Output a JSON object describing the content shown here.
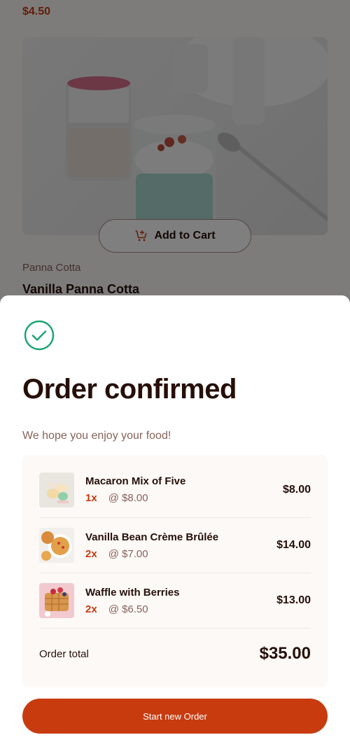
{
  "background": {
    "prev_price": "$4.50",
    "add_to_cart_label": "Add to Cart",
    "product_category": "Panna Cotta",
    "product_name": "Vanilla Panna Cotta"
  },
  "modal": {
    "title": "Order confirmed",
    "subtitle": "We hope you enjoy your food!",
    "items": [
      {
        "name": "Macaron Mix of Five",
        "qty": "1x",
        "unit_price": "@ $8.00",
        "total": "$8.00",
        "icon": "macaron-thumbnail"
      },
      {
        "name": "Vanilla Bean Crème Brûlée",
        "qty": "2x",
        "unit_price": "@ $7.00",
        "total": "$14.00",
        "icon": "creme-brulee-thumbnail"
      },
      {
        "name": "Waffle with Berries",
        "qty": "2x",
        "unit_price": "@ $6.50",
        "total": "$13.00",
        "icon": "waffle-thumbnail"
      }
    ],
    "total_label": "Order total",
    "total_value": "$35.00",
    "start_new_label": "Start new Order"
  },
  "colors": {
    "accent": "#c73b0f",
    "success": "#1ea575",
    "text_dark": "#260f08",
    "text_muted": "#87635a",
    "surface": "#fcf9f7"
  }
}
